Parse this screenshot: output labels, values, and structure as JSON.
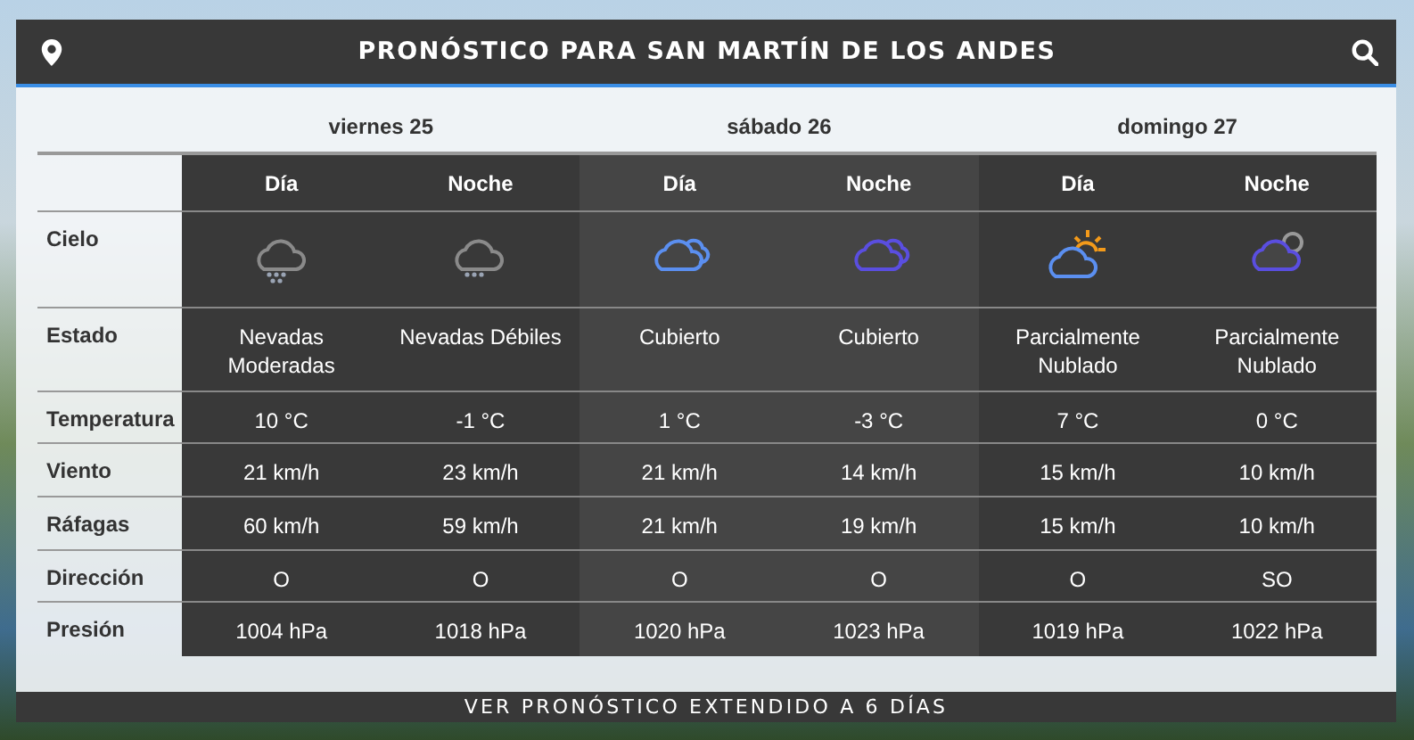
{
  "header": {
    "title": "PRONÓSTICO PARA SAN MARTÍN DE LOS ANDES"
  },
  "rows": [
    {
      "label": "Cielo",
      "kind": "icon"
    },
    {
      "label": "Estado",
      "kind": "text"
    },
    {
      "label": "Temperatura",
      "kind": "text"
    },
    {
      "label": "Viento",
      "kind": "text"
    },
    {
      "label": "Ráfagas",
      "kind": "text"
    },
    {
      "label": "Dirección",
      "kind": "text"
    },
    {
      "label": "Presión",
      "kind": "text"
    }
  ],
  "days": [
    {
      "label": "viernes 25",
      "periods": [
        {
          "label": "Día",
          "kind": "snow-heavy",
          "cells": [
            "Nevadas Moderadas",
            "10 °C",
            "21 km/h",
            "60 km/h",
            "O",
            "1004 hPa"
          ]
        },
        {
          "label": "Noche",
          "kind": "snow-light",
          "cells": [
            "Nevadas Débiles",
            "-1 °C",
            "23 km/h",
            "59 km/h",
            "O",
            "1018 hPa"
          ]
        }
      ]
    },
    {
      "label": "sábado 26",
      "periods": [
        {
          "label": "Día",
          "kind": "cloudy-day",
          "cells": [
            "Cubierto",
            "1 °C",
            "21 km/h",
            "21 km/h",
            "O",
            "1020 hPa"
          ]
        },
        {
          "label": "Noche",
          "kind": "cloudy-night",
          "cells": [
            "Cubierto",
            "-3 °C",
            "14 km/h",
            "19 km/h",
            "O",
            "1023 hPa"
          ]
        }
      ]
    },
    {
      "label": "domingo 27",
      "periods": [
        {
          "label": "Día",
          "kind": "partly-day",
          "cells": [
            "Parcialmente Nublado",
            "7 °C",
            "15 km/h",
            "15 km/h",
            "O",
            "1019 hPa"
          ]
        },
        {
          "label": "Noche",
          "kind": "partly-night",
          "cells": [
            "Parcialmente Nublado",
            "0 °C",
            "10 km/h",
            "10 km/h",
            "SO",
            "1022 hPa"
          ]
        }
      ]
    }
  ],
  "footer": {
    "link": "VER PRONÓSTICO EXTENDIDO A 6 DÍAS"
  }
}
